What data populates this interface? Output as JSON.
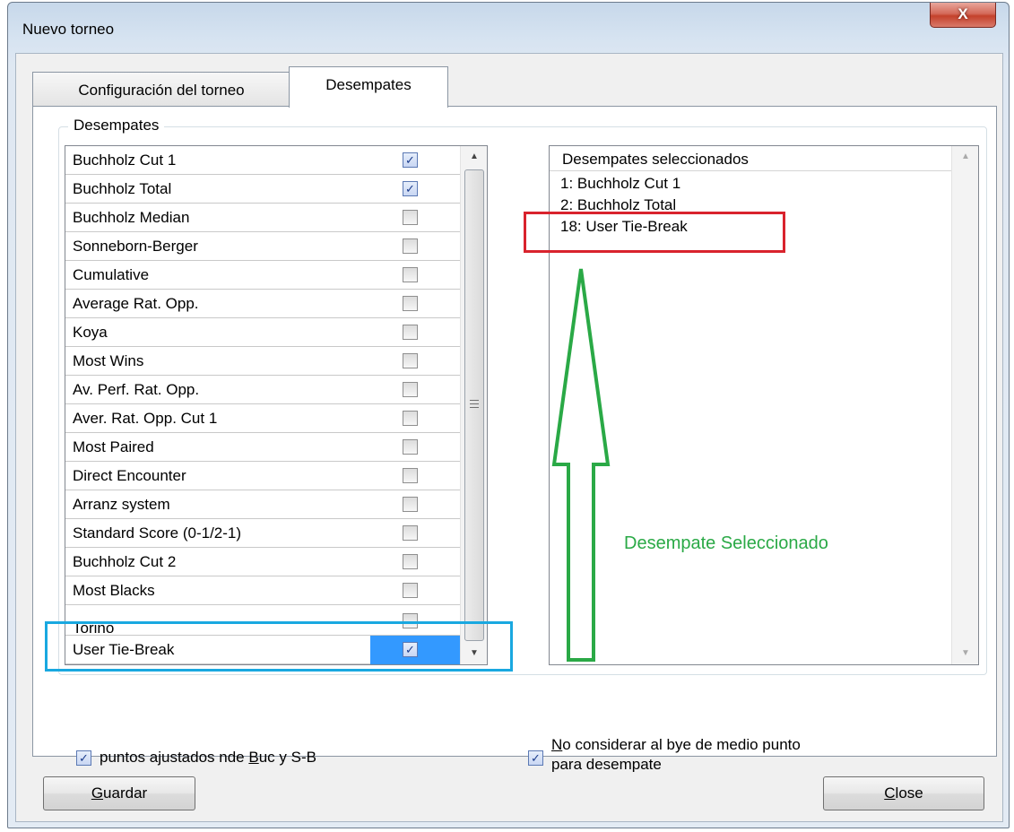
{
  "window": {
    "title": "Nuevo torneo",
    "close_glyph": "X"
  },
  "tabs": [
    {
      "label": "Configuración del torneo",
      "active": false
    },
    {
      "label": "Desempates",
      "active": true
    }
  ],
  "group": {
    "legend": "Desempates"
  },
  "tiebreak_list": {
    "items": [
      {
        "label": "Buchholz Cut 1",
        "checked": true
      },
      {
        "label": "Buchholz Total",
        "checked": true
      },
      {
        "label": "Buchholz Median",
        "checked": false
      },
      {
        "label": "Sonneborn-Berger",
        "checked": false
      },
      {
        "label": "Cumulative",
        "checked": false
      },
      {
        "label": "Average Rat. Opp.",
        "checked": false
      },
      {
        "label": "Koya",
        "checked": false
      },
      {
        "label": "Most Wins",
        "checked": false
      },
      {
        "label": "Av. Perf. Rat. Opp.",
        "checked": false
      },
      {
        "label": "Aver. Rat. Opp. Cut 1",
        "checked": false
      },
      {
        "label": "Most Paired",
        "checked": false
      },
      {
        "label": "Direct Encounter",
        "checked": false
      },
      {
        "label": "Arranz system",
        "checked": false
      },
      {
        "label": "Standard Score (0-1/2-1)",
        "checked": false
      },
      {
        "label": "Buchholz Cut 2",
        "checked": false
      },
      {
        "label": "Most Blacks",
        "checked": false
      },
      {
        "label": "Torino",
        "checked": false
      },
      {
        "label": "User Tie-Break",
        "checked": true,
        "selected": true
      }
    ]
  },
  "selected_list": {
    "header": "Desempates seleccionados",
    "items": [
      "1: Buchholz Cut 1",
      "2: Buchholz Total",
      "18: User Tie-Break"
    ]
  },
  "annotation": {
    "text": "Desempate Seleccionado",
    "arrow_color": "#2aa946",
    "red_box_color": "#d9232d",
    "blue_box_color": "#19a8e0"
  },
  "options": {
    "adjusted_points": {
      "label_pre": "puntos ajustados nde ",
      "label_key": "B",
      "label_post": "uc y S-B",
      "checked": true
    },
    "no_bye": {
      "label_key": "N",
      "label_line1_rest": "o considerar al bye de medio punto",
      "label_line2": "para desempate",
      "checked": true
    }
  },
  "buttons": {
    "save": {
      "key": "G",
      "rest": "uardar"
    },
    "close": {
      "key": "C",
      "rest": "lose"
    }
  },
  "checkmark": "✓"
}
